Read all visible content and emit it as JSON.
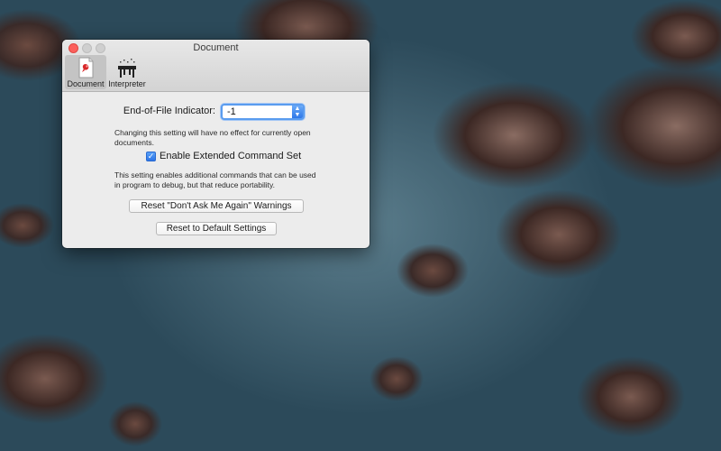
{
  "window": {
    "title": "Document"
  },
  "toolbar": {
    "items": [
      {
        "label": "Document",
        "icon": "document-icon",
        "selected": true
      },
      {
        "label": "Interpreter",
        "icon": "interpreter-icon",
        "selected": false
      }
    ]
  },
  "document_prefs": {
    "eof_label": "End-of-File Indicator:",
    "eof_value": "-1",
    "eof_help": "Changing this setting will have no effect for currently open documents.",
    "extended_label": "Enable Extended Command Set",
    "extended_checked": true,
    "extended_help": "This setting enables additional commands that can be used in program to debug, but that reduce portability.",
    "reset_warnings_label": "Reset \"Don't Ask Me Again\" Warnings",
    "reset_defaults_label": "Reset to Default Settings"
  },
  "colors": {
    "accent": "#3b82f0",
    "close_button": "#fc605c",
    "window_bg": "#ececec"
  }
}
